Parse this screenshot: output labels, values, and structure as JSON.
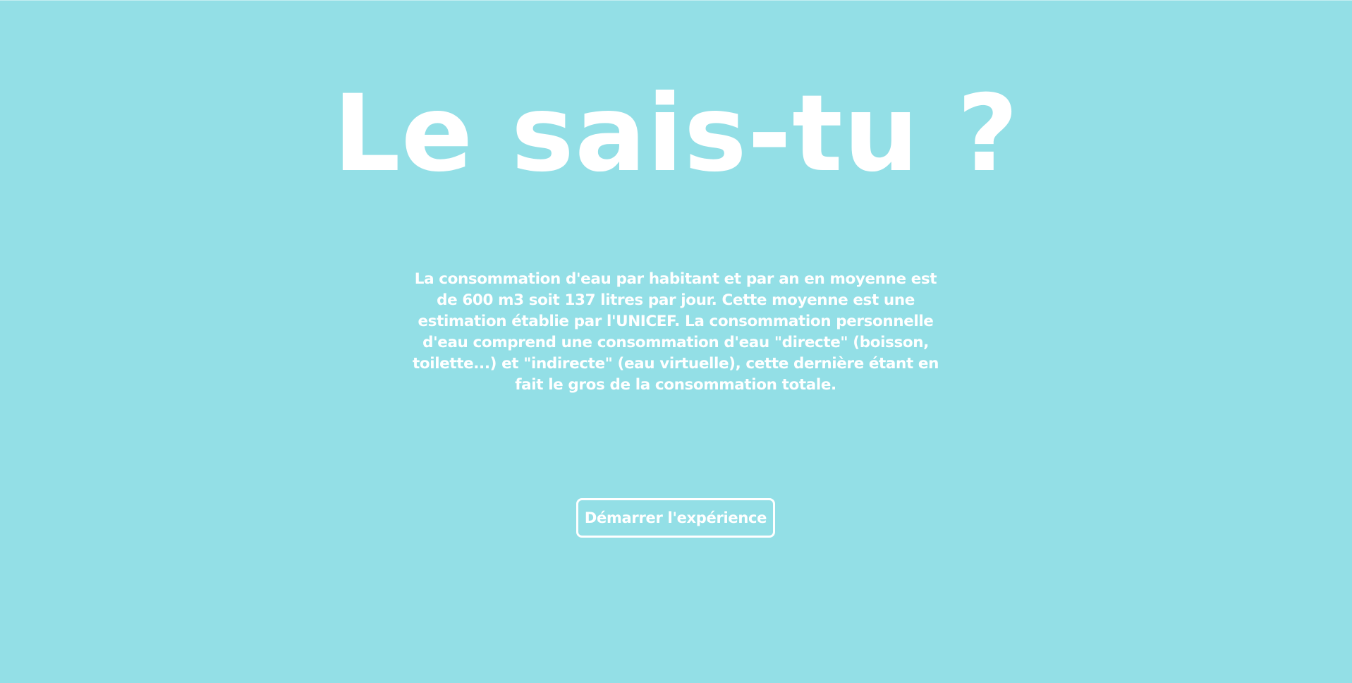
{
  "hero": {
    "title": "Le sais-tu ?"
  },
  "intro": {
    "text": "La consommation d'eau par habitant et par an en moyenne est de 600 m3 soit 137 litres par jour. Cette moyenne est une estimation établie par l'UNICEF. La consommation personnelle d'eau comprend une consommation d'eau \"directe\" (boisson, toilette...) et \"indirecte\" (eau virtuelle), cette dernière étant en fait le gros de la consommation totale."
  },
  "actions": {
    "start_label": "Démarrer l'expérience"
  },
  "colors": {
    "background": "#93dfe6",
    "text": "#ffffff"
  }
}
